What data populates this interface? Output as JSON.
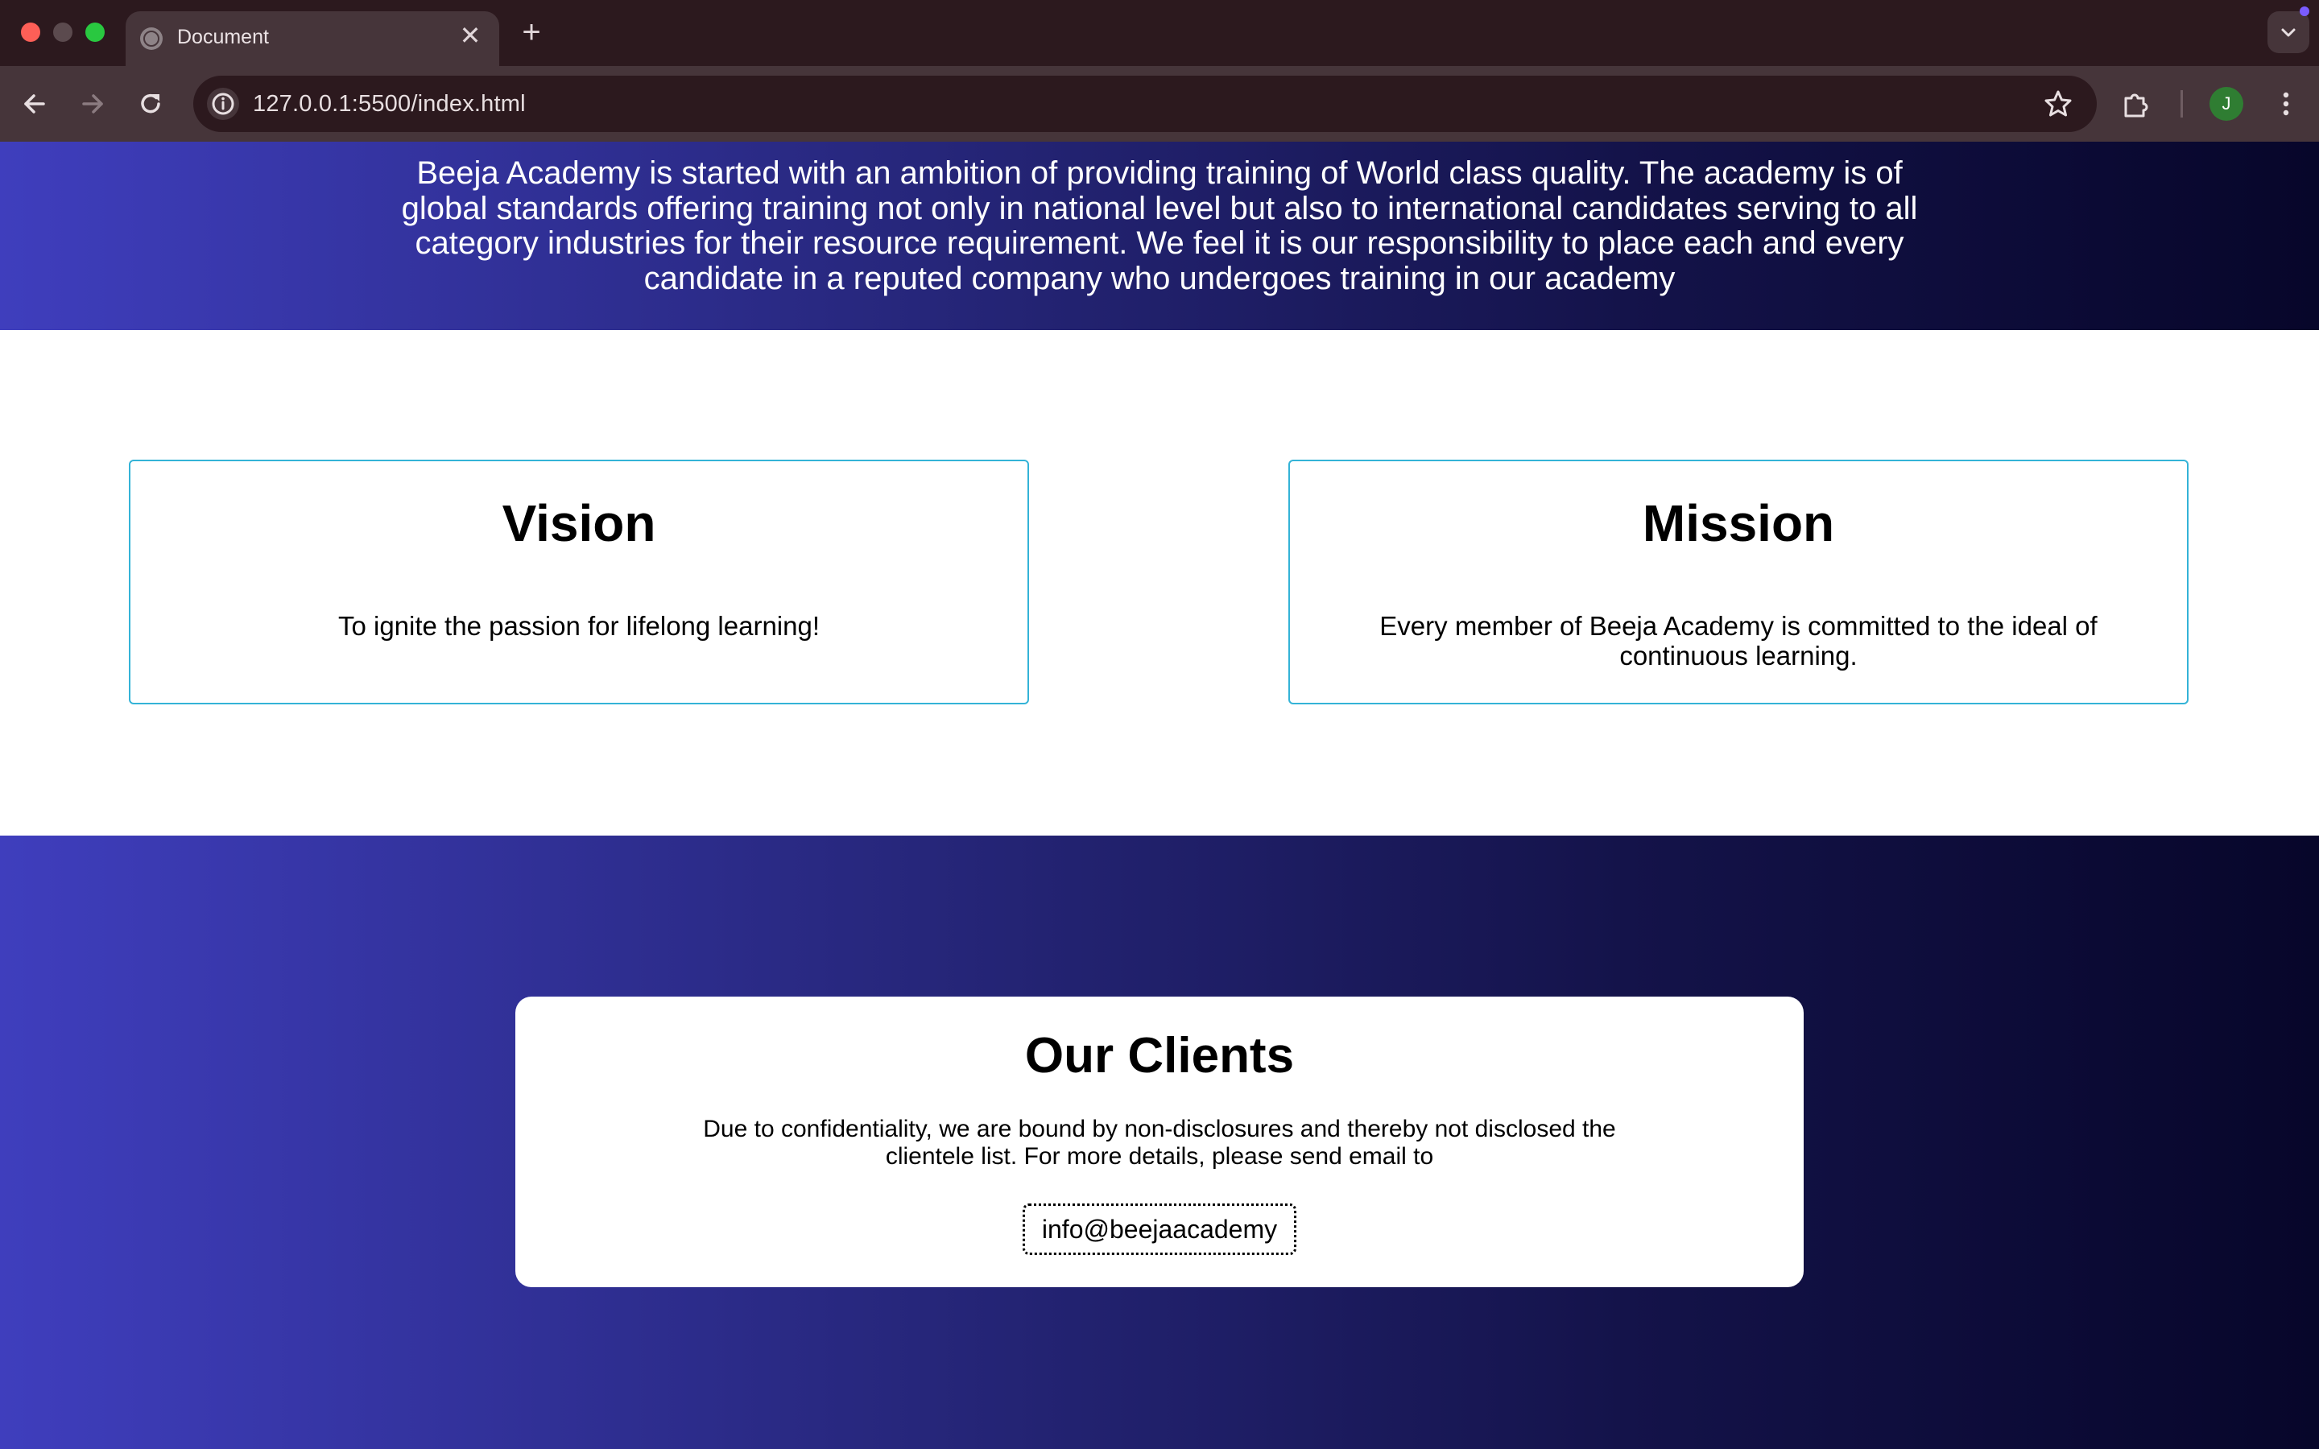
{
  "browser": {
    "tab_title": "Document",
    "tab_close_glyph": "✕",
    "new_tab_glyph": "+",
    "url": "127.0.0.1:5500/index.html",
    "profile_initial": "J",
    "icons": [
      "globe-icon",
      "back-icon",
      "forward-icon",
      "reload-icon",
      "info-icon",
      "star-icon",
      "extensions-icon",
      "kebab-menu-icon",
      "tab-search-chevron-icon"
    ]
  },
  "hero": {
    "text": "Beeja Academy is started with an ambition of providing training of World class quality. The academy is of global standards offering training not only in national level but also to international candidates serving to all category industries for their resource requirement. We feel it is our responsibility to place each and every candidate in a reputed company who undergoes training in our academy"
  },
  "vision": {
    "title": "Vision",
    "text": "To ignite the passion for lifelong learning!"
  },
  "mission": {
    "title": "Mission",
    "text": "Every member of Beeja Academy is committed to the ideal of continuous learning."
  },
  "clients": {
    "title": "Our Clients",
    "text": "Due to confidentiality, we are bound by non-disclosures and thereby not disclosed the clientele list. For more details, please send email to",
    "email": "info@beejaacademy"
  },
  "colors": {
    "gradient_start": "#3f3ebd",
    "gradient_end": "#07062a",
    "card_border": "#34b3d7",
    "chrome_dark": "#2c191e",
    "chrome_mid": "#46353a"
  }
}
